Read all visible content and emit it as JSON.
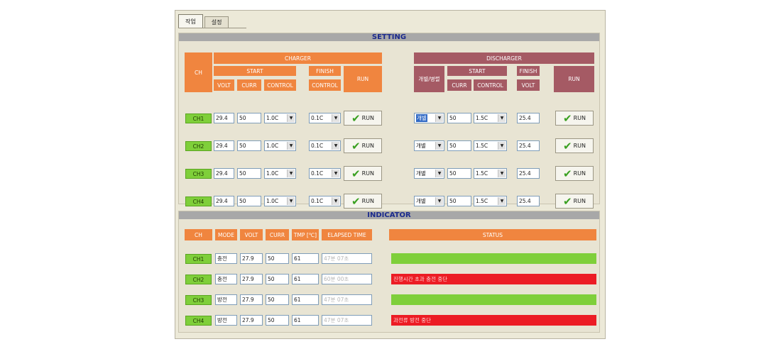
{
  "tabs": [
    {
      "label": "작업"
    },
    {
      "label": "설정"
    }
  ],
  "setting": {
    "title": "SETTING",
    "headers": {
      "ch": "CH",
      "charger": "CHARGER",
      "charger_start": "START",
      "charger_finish": "FINISH",
      "charger_run": "RUN",
      "volt": "VOLT",
      "curr": "CURR",
      "control": "CONTROL",
      "finish_control": "CONTROL",
      "discharger": "DISCHARGER",
      "mode_col": "개별/병렬",
      "dis_start": "START",
      "dis_finish": "FINISH",
      "dis_run": "RUN",
      "dis_curr": "CURR",
      "dis_control": "CONTROL",
      "dis_volt": "VOLT"
    },
    "rows": [
      {
        "ch": "CH1",
        "volt": "29.4",
        "curr": "50",
        "control": "1.0C",
        "finish": "0.1C",
        "run": "RUN",
        "mode": "개별",
        "dis_curr": "50",
        "dis_control": "1.5C",
        "dis_volt": "25.4",
        "dis_run": "RUN"
      },
      {
        "ch": "CH2",
        "volt": "29.4",
        "curr": "50",
        "control": "1.0C",
        "finish": "0.1C",
        "run": "RUN",
        "mode": "개별",
        "dis_curr": "50",
        "dis_control": "1.5C",
        "dis_volt": "25.4",
        "dis_run": "RUN"
      },
      {
        "ch": "CH3",
        "volt": "29.4",
        "curr": "50",
        "control": "1.0C",
        "finish": "0.1C",
        "run": "RUN",
        "mode": "개별",
        "dis_curr": "50",
        "dis_control": "1.5C",
        "dis_volt": "25.4",
        "dis_run": "RUN"
      },
      {
        "ch": "CH4",
        "volt": "29.4",
        "curr": "50",
        "control": "1.0C",
        "finish": "0.1C",
        "run": "RUN",
        "mode": "개별",
        "dis_curr": "50",
        "dis_control": "1.5C",
        "dis_volt": "25.4",
        "dis_run": "RUN"
      }
    ]
  },
  "indicator": {
    "title": "INDICATOR",
    "headers": {
      "ch": "CH",
      "mode": "MODE",
      "volt": "VOLT",
      "curr": "CURR",
      "tmp": "TMP [℃]",
      "elapsed": "ELAPSED TIME",
      "status": "STATUS"
    },
    "rows": [
      {
        "ch": "CH1",
        "mode": "충전",
        "volt": "27.9",
        "curr": "50",
        "tmp": "61",
        "elapsed": "47분 07초",
        "status": "",
        "status_color": "#7fcf3a"
      },
      {
        "ch": "CH2",
        "mode": "충전",
        "volt": "27.9",
        "curr": "50",
        "tmp": "61",
        "elapsed": "60분 00초",
        "status": "진행시간 초과 충전 중단",
        "status_color": "#ec1c24"
      },
      {
        "ch": "CH3",
        "mode": "방전",
        "volt": "27.9",
        "curr": "50",
        "tmp": "61",
        "elapsed": "47분 07초",
        "status": "",
        "status_color": "#7fcf3a"
      },
      {
        "ch": "CH4",
        "mode": "방전",
        "volt": "27.9",
        "curr": "50",
        "tmp": "61",
        "elapsed": "47분 07초",
        "status": "과전류 방전 중단",
        "status_color": "#ec1c24"
      }
    ]
  },
  "icons": {
    "check": "check-icon",
    "dropdown": "chevron-down-icon"
  }
}
